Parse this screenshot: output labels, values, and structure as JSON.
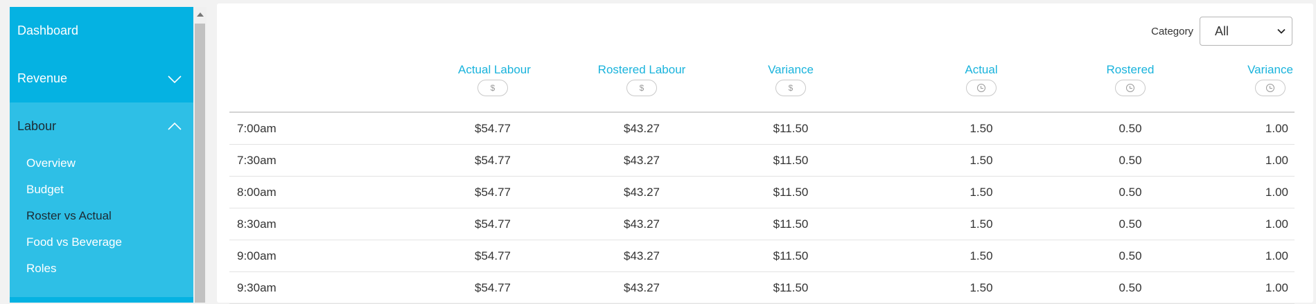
{
  "sidebar": {
    "items": [
      {
        "label": "Dashboard"
      },
      {
        "label": "Revenue"
      },
      {
        "label": "Labour"
      }
    ],
    "labour_sub": [
      {
        "label": "Overview"
      },
      {
        "label": "Budget"
      },
      {
        "label": "Roster vs Actual"
      },
      {
        "label": "Food vs Beverage"
      },
      {
        "label": "Roles"
      }
    ]
  },
  "filter": {
    "label": "Category",
    "selected": "All"
  },
  "table": {
    "headers": [
      {
        "title": "Actual Labour",
        "unit": "$",
        "icon": "dollar-icon"
      },
      {
        "title": "Rostered Labour",
        "unit": "$",
        "icon": "dollar-icon"
      },
      {
        "title": "Variance",
        "unit": "$",
        "icon": "dollar-icon"
      },
      {
        "title": "Actual",
        "unit": "",
        "icon": "clock-icon"
      },
      {
        "title": "Rostered",
        "unit": "",
        "icon": "clock-icon"
      },
      {
        "title": "Variance",
        "unit": "",
        "icon": "clock-icon"
      }
    ],
    "rows": [
      {
        "time": "7:00am",
        "actual_labour": "$54.77",
        "rostered_labour": "$43.27",
        "variance_cost": "$11.50",
        "actual": "1.50",
        "rostered": "0.50",
        "variance": "1.00"
      },
      {
        "time": "7:30am",
        "actual_labour": "$54.77",
        "rostered_labour": "$43.27",
        "variance_cost": "$11.50",
        "actual": "1.50",
        "rostered": "0.50",
        "variance": "1.00"
      },
      {
        "time": "8:00am",
        "actual_labour": "$54.77",
        "rostered_labour": "$43.27",
        "variance_cost": "$11.50",
        "actual": "1.50",
        "rostered": "0.50",
        "variance": "1.00"
      },
      {
        "time": "8:30am",
        "actual_labour": "$54.77",
        "rostered_labour": "$43.27",
        "variance_cost": "$11.50",
        "actual": "1.50",
        "rostered": "0.50",
        "variance": "1.00"
      },
      {
        "time": "9:00am",
        "actual_labour": "$54.77",
        "rostered_labour": "$43.27",
        "variance_cost": "$11.50",
        "actual": "1.50",
        "rostered": "0.50",
        "variance": "1.00"
      },
      {
        "time": "9:30am",
        "actual_labour": "$54.77",
        "rostered_labour": "$43.27",
        "variance_cost": "$11.50",
        "actual": "1.50",
        "rostered": "0.50",
        "variance": "1.00"
      }
    ]
  },
  "colors": {
    "sidebar_top": "#05b2e2",
    "sidebar_active": "#2ebfe6",
    "header_text": "#19b3dc"
  }
}
